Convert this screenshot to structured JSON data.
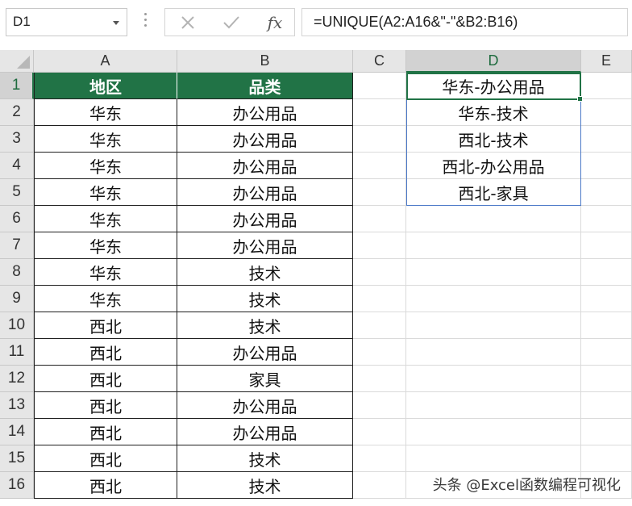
{
  "name_box": {
    "value": "D1"
  },
  "formula_bar": {
    "formula": "=UNIQUE(A2:A16&\"-\"&B2:B16)",
    "cancel_icon": "close-icon",
    "enter_icon": "check-icon",
    "function_label": "fx"
  },
  "columns": [
    "A",
    "B",
    "C",
    "D",
    "E"
  ],
  "active_column": "D",
  "rows": [
    "1",
    "2",
    "3",
    "4",
    "5",
    "6",
    "7",
    "8",
    "9",
    "10",
    "11",
    "12",
    "13",
    "14",
    "15",
    "16"
  ],
  "active_row": "1",
  "colors": {
    "header_fill": "#217346",
    "header_text": "#ffffff",
    "selection": "#217346",
    "spill_border": "#4a78c7"
  },
  "table": {
    "headers": [
      "地区",
      "品类"
    ],
    "rows": [
      [
        "华东",
        "办公用品"
      ],
      [
        "华东",
        "办公用品"
      ],
      [
        "华东",
        "办公用品"
      ],
      [
        "华东",
        "办公用品"
      ],
      [
        "华东",
        "办公用品"
      ],
      [
        "华东",
        "办公用品"
      ],
      [
        "华东",
        "技术"
      ],
      [
        "华东",
        "技术"
      ],
      [
        "西北",
        "技术"
      ],
      [
        "西北",
        "办公用品"
      ],
      [
        "西北",
        "家具"
      ],
      [
        "西北",
        "办公用品"
      ],
      [
        "西北",
        "办公用品"
      ],
      [
        "西北",
        "技术"
      ],
      [
        "西北",
        "技术"
      ]
    ]
  },
  "result": {
    "cell": "D1",
    "values": [
      "华东-办公用品",
      "华东-技术",
      "西北-技术",
      "西北-办公用品",
      "西北-家具"
    ]
  },
  "watermark": "头条 @Excel函数编程可视化"
}
